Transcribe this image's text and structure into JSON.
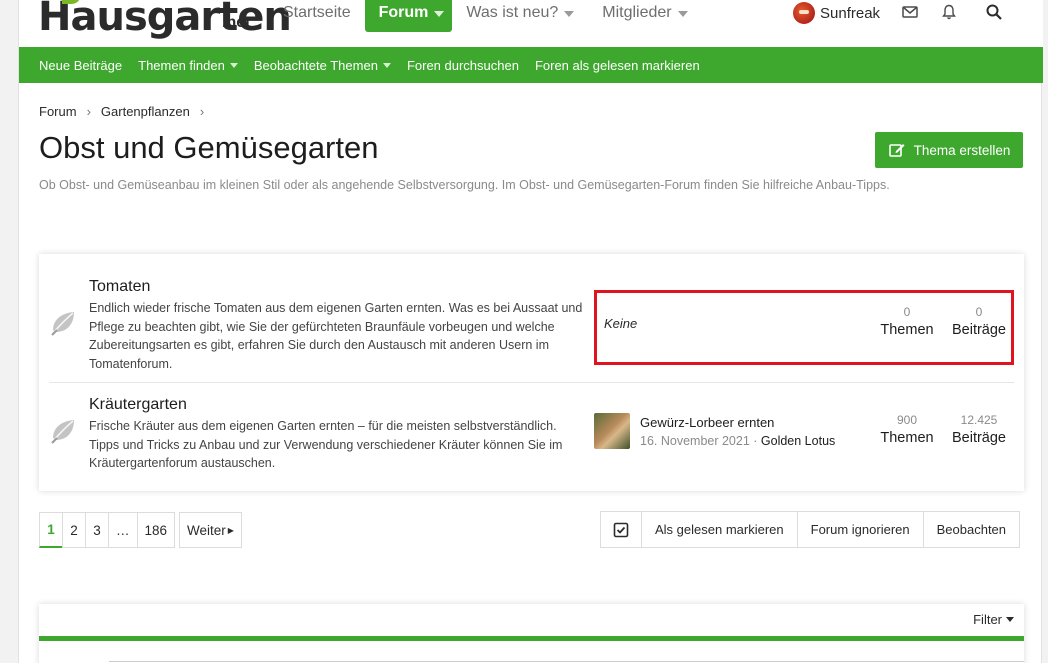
{
  "header": {
    "logo_main": "Hausgarten",
    "logo_net": ".net",
    "nav": [
      {
        "label": "Startseite"
      },
      {
        "label": "Forum"
      },
      {
        "label": "Was ist neu?"
      },
      {
        "label": "Mitglieder"
      }
    ],
    "username": "Sunfreak"
  },
  "subnav": [
    {
      "label": "Neue Beiträge"
    },
    {
      "label": "Themen finden"
    },
    {
      "label": "Beobachtete Themen"
    },
    {
      "label": "Foren durchsuchen"
    },
    {
      "label": "Foren als gelesen markieren"
    }
  ],
  "breadcrumb": [
    "Forum",
    "Gartenpflanzen"
  ],
  "page": {
    "title": "Obst und Gemüsegarten",
    "description": "Ob Obst- und Gemüseanbau im kleinen Stil oder als angehende Selbstversorgung. Im Obst- und Gemüsegarten-Forum finden Sie hilfreiche Anbau-Tipps.",
    "create_button": "Thema erstellen"
  },
  "nodes": [
    {
      "title": "Tomaten",
      "description": "Endlich wieder frische Tomaten aus dem eigenen Garten ernten. Was es bei Aussaat und Pflege zu beachten gibt, wie Sie der gefürchteten Braunfäule vorbeugen und welche Zubereitungsarten es gibt, erfahren Sie durch den Austausch mit anderen Usern im Tomatenforum.",
      "latest": "Keine",
      "threads": "0",
      "threads_label": "Themen",
      "posts": "0",
      "posts_label": "Beiträge"
    },
    {
      "title": "Kräutergarten",
      "description": "Frische Kräuter aus dem eigenen Garten ernten – für die meisten selbstverständlich. Tipps und Tricks zu Anbau und zur Verwendung verschiedener Kräuter können Sie im Kräutergartenforum austauschen.",
      "latest_title": "Gewürz-Lorbeer ernten",
      "latest_date": "16. November 2021",
      "latest_sep": " · ",
      "latest_author": "Golden Lotus",
      "threads": "900",
      "threads_label": "Themen",
      "posts": "12.425",
      "posts_label": "Beiträge"
    }
  ],
  "pagination": {
    "pages": [
      "1",
      "2",
      "3",
      "…",
      "186"
    ],
    "next": "Weiter"
  },
  "actions": {
    "mark_read": "Als gelesen markieren",
    "ignore": "Forum ignorieren",
    "watch": "Beobachten"
  },
  "filter_label": "Filter",
  "colors": {
    "accent": "#3ea82e",
    "highlight": "#e0141e"
  }
}
